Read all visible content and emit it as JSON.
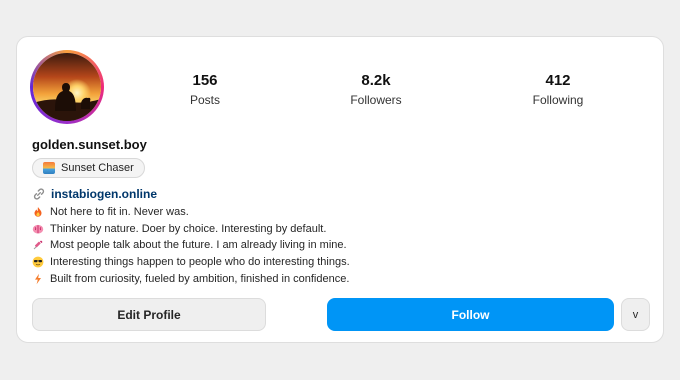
{
  "profile": {
    "username": "golden.sunset.boy",
    "category": "Sunset Chaser",
    "link": "instabiogen.online"
  },
  "stats": {
    "posts_value": "156",
    "posts_label": "Posts",
    "followers_value": "8.2k",
    "followers_label": "Followers",
    "following_value": "412",
    "following_label": "Following"
  },
  "bio": {
    "lines": [
      {
        "icon": "fire-icon",
        "text": "Not here to fit in. Never was."
      },
      {
        "icon": "brain-icon",
        "text": "Thinker by nature. Doer by choice. Interesting by default."
      },
      {
        "icon": "syringe-icon",
        "text": "Most people talk about the future. I am already living in mine."
      },
      {
        "icon": "sunglasses-face-icon",
        "text": "Interesting things happen to people who do interesting things."
      },
      {
        "icon": "lightning-icon",
        "text": "Built from curiosity, fueled by ambition, finished in confidence."
      }
    ]
  },
  "actions": {
    "edit_label": "Edit Profile",
    "follow_label": "Follow",
    "more_label": "v"
  },
  "colors": {
    "follow_button": "#0095f6",
    "link": "#00376b",
    "card_background": "#ffffff",
    "page_background": "#efefef"
  }
}
